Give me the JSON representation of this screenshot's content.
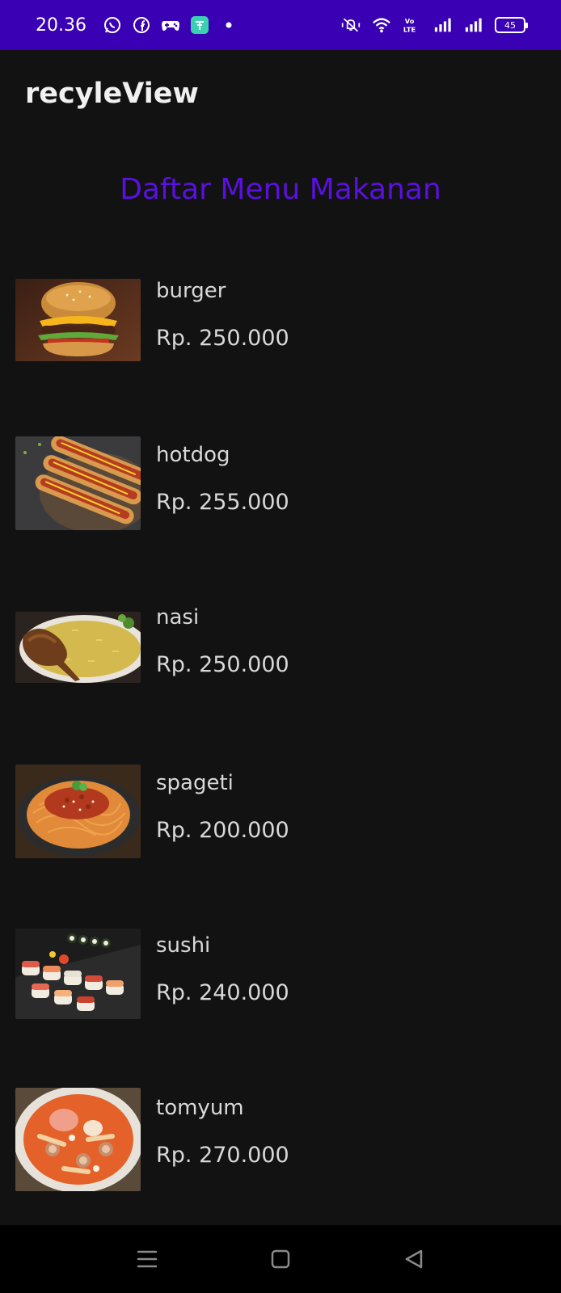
{
  "status": {
    "time": "20.36",
    "battery": "45",
    "left_icons": [
      "whatsapp-icon",
      "facebook-icon",
      "gamepad-icon",
      "app-icon",
      "dot-icon"
    ],
    "right_icons": [
      "mute-vibrate-icon",
      "wifi-icon",
      "volte-icon",
      "signal-icon",
      "signal-icon"
    ]
  },
  "app_bar": {
    "title": "recyleView"
  },
  "section": {
    "title": "Daftar Menu Makanan",
    "color": "#5a10e0"
  },
  "menu": [
    {
      "name": "burger",
      "price": "Rp. 250.000"
    },
    {
      "name": "hotdog",
      "price": "Rp. 255.000"
    },
    {
      "name": "nasi",
      "price": "Rp. 250.000"
    },
    {
      "name": "spageti",
      "price": "Rp. 200.000"
    },
    {
      "name": "sushi",
      "price": "Rp. 240.000"
    },
    {
      "name": "tomyum",
      "price": "Rp. 270.000"
    }
  ],
  "nav": {
    "buttons": [
      "menu-icon",
      "home-icon",
      "back-icon"
    ]
  },
  "colors": {
    "status_bar": "#3a00b3",
    "background": "#121212",
    "nav_bar": "#000000"
  }
}
